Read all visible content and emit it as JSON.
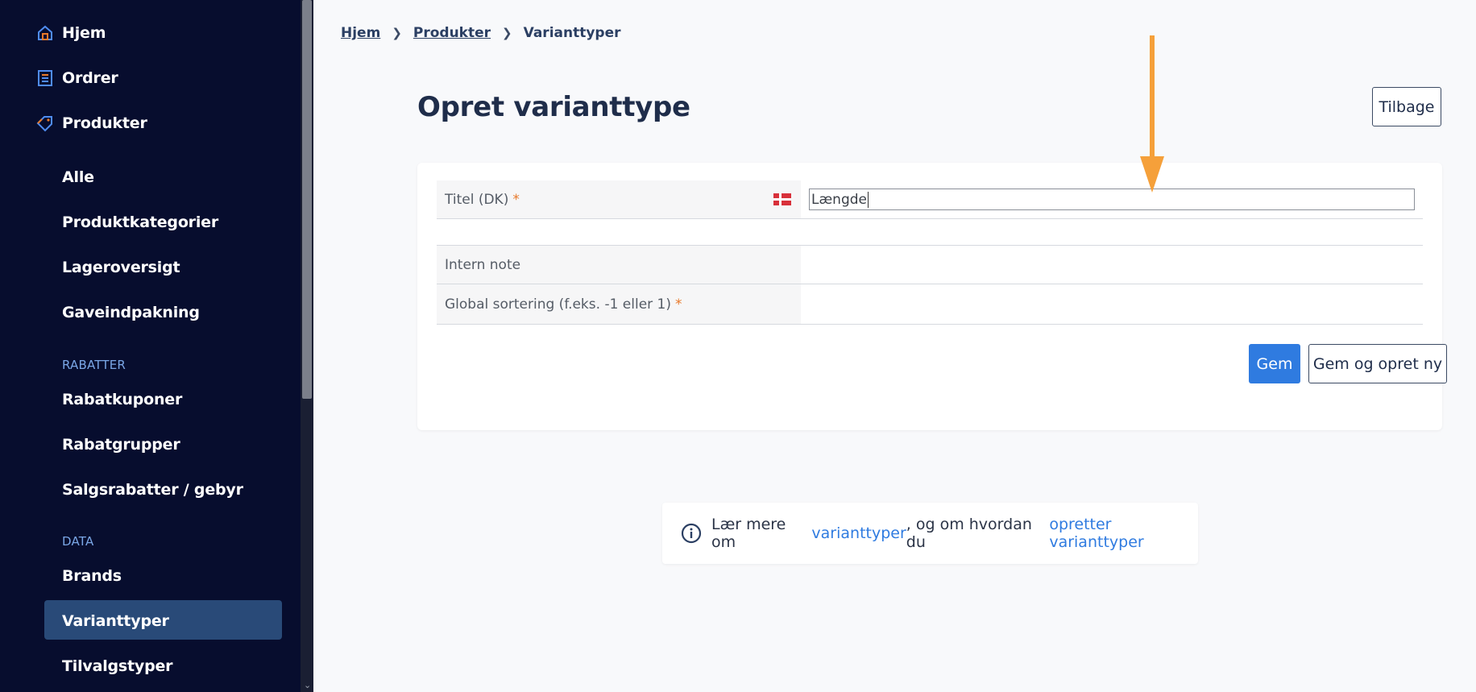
{
  "sidebar": {
    "main_items": [
      {
        "label": "Hjem",
        "icon": "home-icon"
      },
      {
        "label": "Ordrer",
        "icon": "orders-icon"
      },
      {
        "label": "Produkter",
        "icon": "tag-icon"
      }
    ],
    "product_sub_items": [
      "Alle",
      "Produktkategorier",
      "Lageroversigt",
      "Gaveindpakning"
    ],
    "section_discounts": "RABATTER",
    "discount_items": [
      "Rabatkuponer",
      "Rabatgrupper",
      "Salgsrabatter / gebyr"
    ],
    "section_data": "DATA",
    "data_items": [
      "Brands",
      "Varianttyper",
      "Tilvalgstyper"
    ],
    "active_item": "Varianttyper"
  },
  "breadcrumb": {
    "items": [
      "Hjem",
      "Produkter",
      "Varianttyper"
    ]
  },
  "page": {
    "title": "Opret varianttype",
    "back_label": "Tilbage"
  },
  "form": {
    "title_label": "Titel (DK)",
    "title_value": "Længde",
    "required_mark": "*",
    "note_label": "Intern note",
    "sort_label": "Global sortering (f.eks. -1 eller 1)",
    "save_label": "Gem",
    "save_new_label": "Gem og opret ny"
  },
  "info": {
    "text_1": "Lær mere om",
    "link_1": "varianttyper",
    "text_2": ", og om hvordan du",
    "link_2": "opretter varianttyper"
  },
  "colors": {
    "sidebar_bg": "#070d2e",
    "active_bg": "#294a78",
    "accent_blue": "#2f7be0",
    "required_orange": "#e8792a",
    "annotation_arrow": "#f5a03a"
  }
}
